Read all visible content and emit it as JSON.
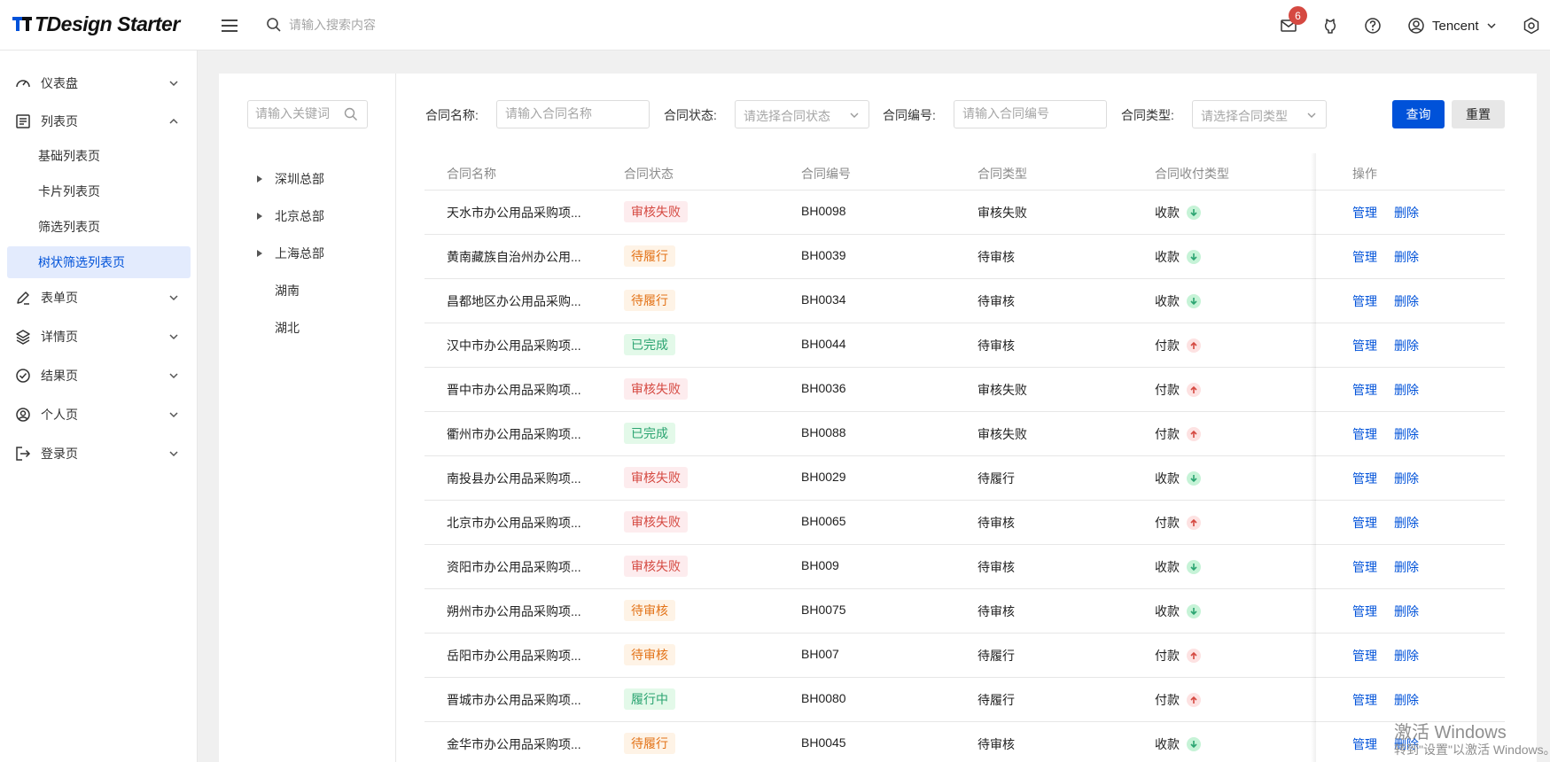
{
  "header": {
    "logo_text": "TDesign Starter",
    "search_placeholder": "请输入搜索内容",
    "notification_count": "6",
    "user_name": "Tencent"
  },
  "sidebar": {
    "items": [
      {
        "label": "仪表盘",
        "icon": "dashboard-icon",
        "expanded": false
      },
      {
        "label": "列表页",
        "icon": "list-icon",
        "expanded": true
      },
      {
        "label": "表单页",
        "icon": "edit-icon",
        "expanded": false
      },
      {
        "label": "详情页",
        "icon": "layers-icon",
        "expanded": false
      },
      {
        "label": "结果页",
        "icon": "check-circle-icon",
        "expanded": false
      },
      {
        "label": "个人页",
        "icon": "user-circle-icon",
        "expanded": false
      },
      {
        "label": "登录页",
        "icon": "logout-icon",
        "expanded": false
      }
    ],
    "sub_items": [
      "基础列表页",
      "卡片列表页",
      "筛选列表页",
      "树状筛选列表页"
    ],
    "active_sub_item": "树状筛选列表页"
  },
  "tree": {
    "search_placeholder": "请输入关键词",
    "nodes": [
      {
        "label": "深圳总部",
        "has_children": true
      },
      {
        "label": "北京总部",
        "has_children": true
      },
      {
        "label": "上海总部",
        "has_children": true
      },
      {
        "label": "湖南",
        "has_children": false
      },
      {
        "label": "湖北",
        "has_children": false
      }
    ]
  },
  "filters": {
    "name_label": "合同名称:",
    "name_placeholder": "请输入合同名称",
    "status_label": "合同状态:",
    "status_placeholder": "请选择合同状态",
    "no_label": "合同编号:",
    "no_placeholder": "请输入合同编号",
    "type_label": "合同类型:",
    "type_placeholder": "请选择合同类型",
    "query_button": "查询",
    "reset_button": "重置"
  },
  "table": {
    "columns": [
      "合同名称",
      "合同状态",
      "合同编号",
      "合同类型",
      "合同收付类型",
      "操作"
    ],
    "manage_label": "管理",
    "delete_label": "删除",
    "rows": [
      {
        "name": "天水市办公用品采购项...",
        "status": "审核失败",
        "status_kind": "fail",
        "no": "BH0098",
        "type": "审核失败",
        "pay": "收款",
        "pay_kind": "in"
      },
      {
        "name": "黄南藏族自治州办公用...",
        "status": "待履行",
        "status_kind": "pending",
        "no": "BH0039",
        "type": "待审核",
        "pay": "收款",
        "pay_kind": "in"
      },
      {
        "name": "昌都地区办公用品采购...",
        "status": "待履行",
        "status_kind": "pending",
        "no": "BH0034",
        "type": "待审核",
        "pay": "收款",
        "pay_kind": "in"
      },
      {
        "name": "汉中市办公用品采购项...",
        "status": "已完成",
        "status_kind": "done",
        "no": "BH0044",
        "type": "待审核",
        "pay": "付款",
        "pay_kind": "out"
      },
      {
        "name": "晋中市办公用品采购项...",
        "status": "审核失败",
        "status_kind": "fail",
        "no": "BH0036",
        "type": "审核失败",
        "pay": "付款",
        "pay_kind": "out"
      },
      {
        "name": "衢州市办公用品采购项...",
        "status": "已完成",
        "status_kind": "done",
        "no": "BH0088",
        "type": "审核失败",
        "pay": "付款",
        "pay_kind": "out"
      },
      {
        "name": "南投县办公用品采购项...",
        "status": "审核失败",
        "status_kind": "fail",
        "no": "BH0029",
        "type": "待履行",
        "pay": "收款",
        "pay_kind": "in"
      },
      {
        "name": "北京市办公用品采购项...",
        "status": "审核失败",
        "status_kind": "fail",
        "no": "BH0065",
        "type": "待审核",
        "pay": "付款",
        "pay_kind": "out"
      },
      {
        "name": "资阳市办公用品采购项...",
        "status": "审核失败",
        "status_kind": "fail",
        "no": "BH009",
        "type": "待审核",
        "pay": "收款",
        "pay_kind": "in"
      },
      {
        "name": "朔州市办公用品采购项...",
        "status": "待审核",
        "status_kind": "pending",
        "no": "BH0075",
        "type": "待审核",
        "pay": "收款",
        "pay_kind": "in"
      },
      {
        "name": "岳阳市办公用品采购项...",
        "status": "待审核",
        "status_kind": "pending",
        "no": "BH007",
        "type": "待履行",
        "pay": "付款",
        "pay_kind": "out"
      },
      {
        "name": "晋城市办公用品采购项...",
        "status": "履行中",
        "status_kind": "done",
        "no": "BH0080",
        "type": "待履行",
        "pay": "付款",
        "pay_kind": "out"
      },
      {
        "name": "金华市办公用品采购项...",
        "status": "待履行",
        "status_kind": "pending",
        "no": "BH0045",
        "type": "待审核",
        "pay": "收款",
        "pay_kind": "in"
      }
    ]
  },
  "watermark": {
    "line1": "激活 Windows",
    "line2": "转到\"设置\"以激活 Windows。"
  },
  "colors": {
    "brand": "#0052d9",
    "fail": "#d54941",
    "pending": "#e37318",
    "done": "#2ba471",
    "active_bg": "#e3ebfd"
  }
}
